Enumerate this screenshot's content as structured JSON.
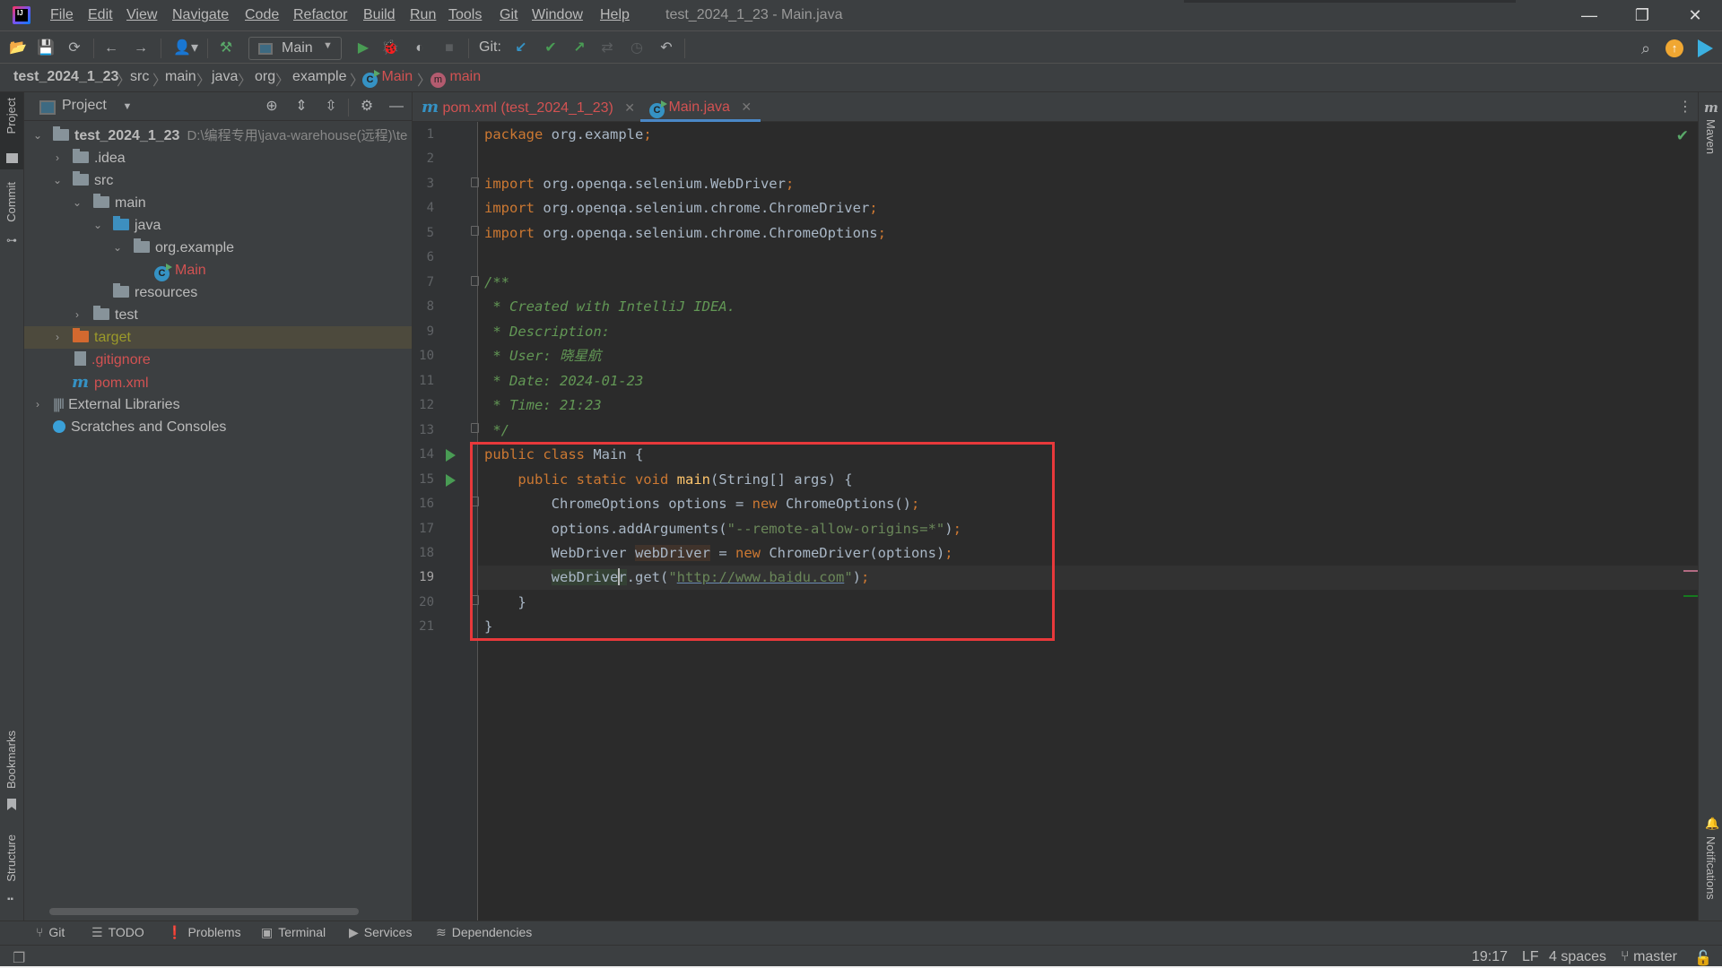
{
  "app": {
    "logo": "IJ",
    "window_title": "test_2024_1_23 - Main.java",
    "menu": [
      "File",
      "Edit",
      "View",
      "Navigate",
      "Code",
      "Refactor",
      "Build",
      "Run",
      "Tools",
      "Git",
      "Window",
      "Help"
    ],
    "window_controls": {
      "minimize": "—",
      "restore": "❐",
      "close": "✕"
    }
  },
  "toolbar": {
    "run_config": "Main",
    "git_label": "Git:",
    "icons": [
      "open-icon",
      "save-icon",
      "sync-icon",
      "back-icon",
      "forward-icon",
      "user-icon",
      "build-icon",
      "run-icon",
      "debug-icon",
      "coverage-icon",
      "stop-icon",
      "git-update-icon",
      "git-commit-icon",
      "git-push-icon",
      "git-compare-icon",
      "git-history-icon",
      "git-rollback-icon",
      "search-icon",
      "update-icon",
      "code-with-me-icon"
    ]
  },
  "breadcrumb": {
    "items": [
      "test_2024_1_23",
      "src",
      "main",
      "java",
      "org",
      "example"
    ],
    "class": "Main",
    "method": "main",
    "class_icon": "C",
    "method_icon": "m"
  },
  "left_strip": {
    "project": "Project",
    "commit": "Commit",
    "bookmarks": "Bookmarks",
    "structure": "Structure"
  },
  "project_panel": {
    "title": "Project",
    "tree": [
      {
        "label": "test_2024_1_23",
        "path": "D:\\编程专用\\java-warehouse(远程)\\te",
        "expanded": true
      },
      {
        "label": ".idea",
        "expanded": false
      },
      {
        "label": "src",
        "expanded": true
      },
      {
        "label": "main",
        "expanded": true
      },
      {
        "label": "java",
        "expanded": true
      },
      {
        "label": "org.example",
        "expanded": true
      },
      {
        "label": "Main"
      },
      {
        "label": "resources"
      },
      {
        "label": "test",
        "expanded": false
      },
      {
        "label": "target",
        "expanded": false,
        "selected": true
      },
      {
        "label": ".gitignore"
      },
      {
        "label": "pom.xml"
      },
      {
        "label": "External Libraries",
        "expanded": false
      },
      {
        "label": "Scratches and Consoles"
      }
    ]
  },
  "tabs": [
    {
      "label": "pom.xml (test_2024_1_23)",
      "icon": "m",
      "active": false
    },
    {
      "label": "Main.java",
      "icon": "C",
      "active": true
    }
  ],
  "editor": {
    "current_line": 19,
    "lines": [
      "1",
      "2",
      "3",
      "4",
      "5",
      "6",
      "7",
      "8",
      "9",
      "10",
      "11",
      "12",
      "13",
      "14",
      "15",
      "16",
      "17",
      "18",
      "19",
      "20",
      "21"
    ],
    "code": {
      "l1_kw": "package",
      "l1_rest": " org.example",
      "semi": ";",
      "import_kw": "import",
      "l3": " org.openqa.selenium.WebDriver",
      "l4": " org.openqa.selenium.chrome.ChromeDriver",
      "l5": " org.openqa.selenium.chrome.ChromeOptions",
      "l7": "/**",
      "l8": " * Created with IntelliJ IDEA.",
      "l9": " * Description:",
      "l10": " * User: 晓星航",
      "l11": " * Date: 2024-01-23",
      "l12": " * Time: 21:23",
      "l13": " */",
      "l14_kw": "public class",
      "l14_rest": " Main {",
      "l15_kw": "    public static void",
      "l15_fn": "main",
      "l15_rest": "(String[] args) {",
      "l16_a": "        ChromeOptions options = ",
      "new_kw": "new",
      "l16_b": " ChromeOptions()",
      "l17_a": "        options.addArguments(",
      "l17_str": "\"--remote-allow-origins=*\"",
      "l17_b": ")",
      "l18_a": "        WebDriver ",
      "l18_var": "webDriver",
      "l18_b": " = ",
      "l18_c": " ChromeDriver(options)",
      "l19_indent": "        ",
      "l19_var_a": "webDrive",
      "l19_var_b": "r",
      "l19_a": ".get(",
      "l19_q": "\"",
      "l19_url": "http://www.baidu.com",
      "l19_b": ")",
      "l20": "    }",
      "l21": "}"
    }
  },
  "right_strip": {
    "maven": "Maven",
    "notifications": "Notifications"
  },
  "bottom_tools": [
    {
      "label": "Git",
      "icon": "git-branch-icon"
    },
    {
      "label": "TODO",
      "icon": "list-icon"
    },
    {
      "label": "Problems",
      "icon": "problems-icon"
    },
    {
      "label": "Terminal",
      "icon": "terminal-icon"
    },
    {
      "label": "Services",
      "icon": "services-icon"
    },
    {
      "label": "Dependencies",
      "icon": "dependencies-icon"
    }
  ],
  "status_bar": {
    "position": "19:17",
    "line_separator": "LF",
    "indent": "4 spaces",
    "branch": "master"
  },
  "colors": {
    "accent": "#4a88c7",
    "highlight_box": "#e8393b",
    "keyword": "#cc7832",
    "comment": "#629755",
    "string": "#6a8759"
  }
}
